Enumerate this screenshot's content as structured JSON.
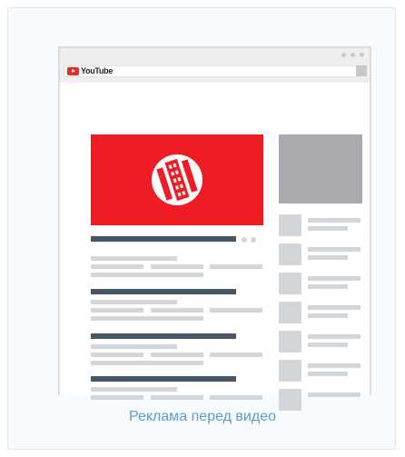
{
  "browser": {
    "site_logo_text": "YouTube"
  },
  "caption": "Реклама перед видео",
  "colors": {
    "ad_red": "#ee1c25",
    "caption_blue": "#5f9ad0",
    "title_bar": "#465867"
  },
  "icons": [
    "film-reel-icon",
    "youtube-play-icon"
  ]
}
